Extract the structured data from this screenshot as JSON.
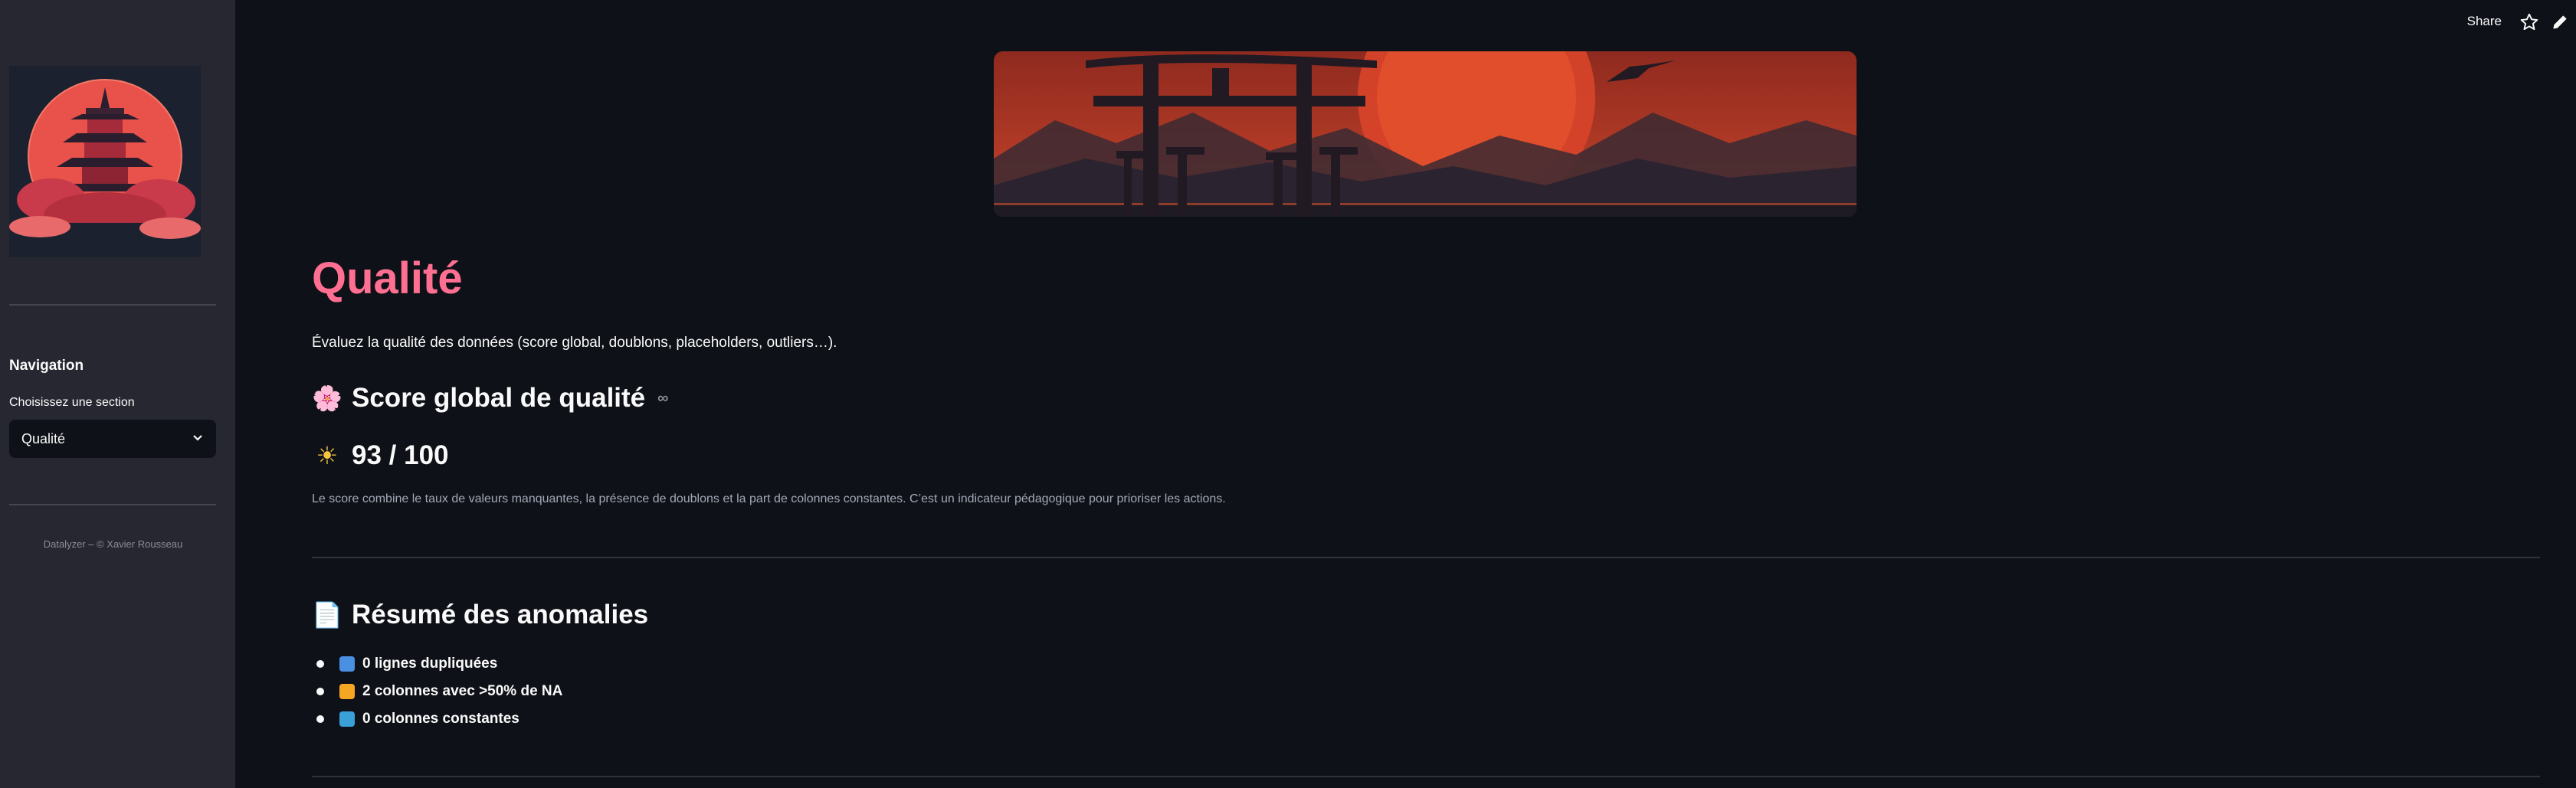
{
  "sidebar": {
    "nav_title": "Navigation",
    "select_label": "Choisissez une section",
    "select_value": "Qualité",
    "footer": "Datalyzer – © Xavier Rousseau"
  },
  "topbar": {
    "share_label": "Share",
    "star_icon": "star-icon",
    "edit_icon": "pencil-icon"
  },
  "main": {
    "title": "Qualité",
    "description": "Évaluez la qualité des données (score global, doublons, placeholders, outliers…).",
    "score_section": {
      "emoji": "🌸",
      "heading": "Score global de qualité",
      "link_icon": "∞"
    },
    "score_value": {
      "emoji": "☀",
      "text": "93 / 100"
    },
    "score_note": "Le score combine le taux de valeurs manquantes, la présence de doublons et la part de colonnes constantes. C’est un indicateur pédagogique pour prioriser les actions.",
    "anomalies": {
      "emoji": "📄",
      "heading": "Résumé des anomalies",
      "items": [
        {
          "label": "0 lignes dupliquées",
          "color": "#4a90e2"
        },
        {
          "label": "2 colonnes avec >50% de NA",
          "color": "#f5a623"
        },
        {
          "label": "0 colonnes constantes",
          "color": "#3aa0d8"
        }
      ]
    }
  },
  "colors": {
    "accent": "#ff6f91",
    "background": "#0e1117",
    "sidebar": "#262730"
  }
}
